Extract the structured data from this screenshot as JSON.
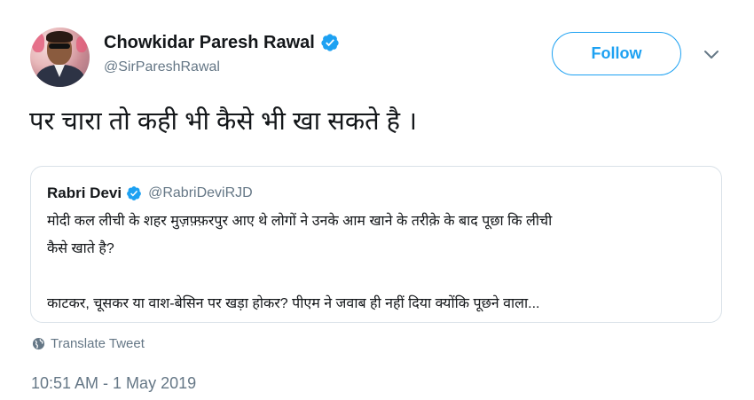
{
  "author": {
    "name": "Chowkidar Paresh Rawal",
    "handle": "@SirPareshRawal",
    "verified": true
  },
  "follow_label": "Follow",
  "tweet_text": "पर चारा तो कही भी कैसे भी खा सकते है ।",
  "quoted": {
    "name": "Rabri Devi",
    "handle": "@RabriDeviRJD",
    "verified": true,
    "line1": "मोदी कल लीची के शहर मुज़फ़्फ़रपुर आए थे लोगों ने उनके आम खाने के तरीक़े के बाद पूछा कि लीची",
    "line2": "कैसे खाते है?",
    "line3": "काटकर, चूसकर या वाश-बेसिन पर खड़ा होकर? पीएम ने जवाब ही नहीं दिया क्योंकि पूछने वाला..."
  },
  "translate_label": "Translate Tweet",
  "timestamp": "10:51 AM - 1 May 2019",
  "colors": {
    "accent": "#1da1f2",
    "muted": "#657786",
    "text": "#14171a",
    "border": "#d9e1e8"
  },
  "icons": [
    "verified-badge-icon",
    "chevron-down-icon",
    "globe-icon"
  ]
}
